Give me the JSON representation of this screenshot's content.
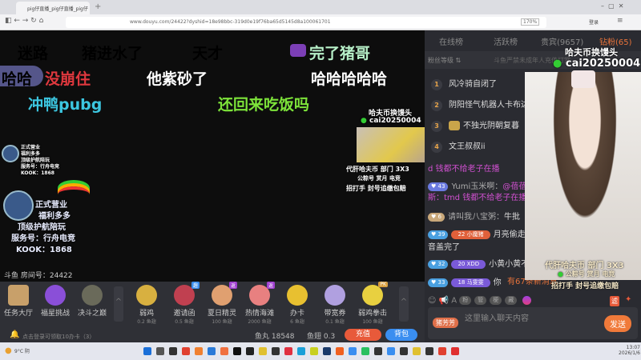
{
  "browser": {
    "tab_title": "pig仔直播_pig仔直播_pig仔 ×",
    "new_tab": "+",
    "url": "www.douyu.com/24422?dyshid=18e98bbc-319d0e19f76ba65d5145d8a100061701",
    "zoom": "170%",
    "login": "登录"
  },
  "danmaku": [
    {
      "text": "迷路",
      "color": "#e8902e"
    },
    {
      "text": "猪进水了",
      "color": "#ffffff"
    },
    {
      "text": "天才",
      "color": "#e0383e"
    },
    {
      "text": "完了猪哥",
      "color": "#b7f0c8"
    },
    {
      "text": "哈哈",
      "color": "#ffffff"
    },
    {
      "text": "没崩住",
      "color": "#e0383e"
    },
    {
      "text": "他紫砂了",
      "color": "#ffffff"
    },
    {
      "text": "哈哈哈哈哈",
      "color": "#ffffff"
    },
    {
      "text": "冲鸭pubg",
      "color": "#3cc6e0"
    },
    {
      "text": "还回来吃饭吗",
      "color": "#7de33a"
    }
  ],
  "overlay_left": {
    "small": [
      "正式营业",
      "福利多多",
      "顶级护航陪玩",
      "服务号：行舟电竞",
      "KOOK：1868"
    ],
    "big": [
      "正式营业",
      "福利多多",
      "顶级护航陪玩",
      "服务号：行舟电竞",
      "KOOK：1868"
    ]
  },
  "overlay_cam": {
    "title": "哈夫币换馒头",
    "wechat": "cai20250004",
    "line1": "代肝哈夫币 部门 3X3",
    "line2": "公粽号 赏月 电竞",
    "line3": "招打手 封号追缴包赔"
  },
  "room_info": "斗鱼 房间号：24422",
  "left_actions": [
    {
      "label": "任务大厅"
    },
    {
      "label": "福星挑战"
    },
    {
      "label": "决斗之巅"
    }
  ],
  "gifts": [
    {
      "name": "弱鸡",
      "price": "0.2 鱼翅",
      "badge": ""
    },
    {
      "name": "邀请函",
      "price": "0.5 鱼翅",
      "badge": "趣"
    },
    {
      "name": "夏日精灵",
      "price": "100 鱼翅",
      "badge": "返"
    },
    {
      "name": "热情海滩",
      "price": "2000 鱼翅",
      "badge": "返"
    },
    {
      "name": "办卡",
      "price": "6 鱼翅",
      "badge": ""
    },
    {
      "name": "带宽券",
      "price": "0.1 鱼翅",
      "badge": ""
    },
    {
      "name": "弱鸡拳击",
      "price": "100 鱼翅",
      "badge": "PK"
    }
  ],
  "wallet": {
    "notice": "点击登录可领取10办卡（3）",
    "yuwan": "鱼丸 18548",
    "yuchi": "鱼翅 0.3",
    "recharge": "充值",
    "backpack": "背包"
  },
  "right": {
    "tabs": [
      "在线榜",
      "活跃榜",
      "贵宾(9657)",
      "钻粉(65)"
    ],
    "fans_level": "粉丝等级 ⇅",
    "notice": "斗鱼严禁未成年人充值打赏",
    "ranking": [
      {
        "rank": "1",
        "name": "风冷骑自闭了"
      },
      {
        "rank": "2",
        "name": "阴阳怪气机器人卡布达"
      },
      {
        "rank": "3",
        "name": "不独光阴朝复暮"
      },
      {
        "rank": "4",
        "name": "文王叔叔ii"
      }
    ],
    "messages": [
      {
        "level": "",
        "fan": "",
        "user": "",
        "text": "d 钱都不给老子在播"
      },
      {
        "level": "43",
        "fan": "",
        "user": "Yumi玉米啊：",
        "text": "@蓓蓓"
      },
      {
        "level": "",
        "fan": "",
        "user": "",
        "text": "斯：tmd 钱都不给老子在播"
      },
      {
        "level": "6",
        "fan": "",
        "user": "请叫我八宝粥：",
        "text": "牛批"
      },
      {
        "level": "39",
        "fan": "22 小魔猪",
        "user": "",
        "text": "月亮偷走"
      },
      {
        "level": "",
        "fan": "",
        "user": "",
        "text": "音盖完了"
      },
      {
        "level": "32",
        "fan": "20 XDD",
        "user": "",
        "text": "小黄小黄不吃"
      },
      {
        "level": "33",
        "fan": "18 马雯雯",
        "user": "",
        "text": "你"
      }
    ],
    "new_messages": "有67条新消息",
    "toolbar": [
      "粉",
      "管",
      "梗",
      "藏"
    ],
    "input_placeholder": "这里输入聊天内容",
    "nickname_badge": "猪芳芳",
    "send": "发送",
    "filter": "滤"
  },
  "taskbar": {
    "weather": "9°C 阴",
    "time": "13:07",
    "date": "2026/1/6"
  }
}
